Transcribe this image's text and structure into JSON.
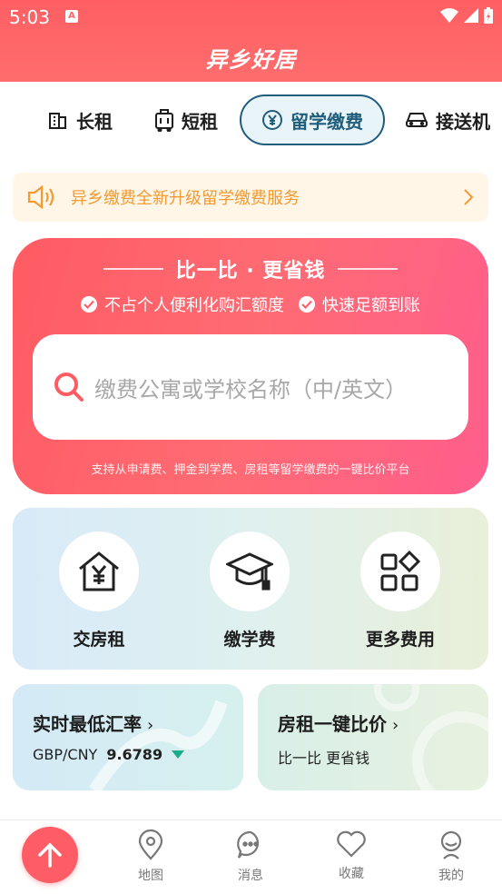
{
  "status_bar": {
    "time": "5:03",
    "notif_letter": "A"
  },
  "header": {
    "title": "异乡好居"
  },
  "tabs": [
    {
      "label": "长租",
      "icon": "building-icon"
    },
    {
      "label": "短租",
      "icon": "suitcase-icon"
    },
    {
      "label": "留学缴费",
      "icon": "yen-circle-icon",
      "active": true
    },
    {
      "label": "接送机",
      "icon": "car-icon"
    }
  ],
  "notice": {
    "text": "异乡缴费全新升级留学缴费服务"
  },
  "hero": {
    "title": "比一比 · 更省钱",
    "features": [
      "不占个人便利化购汇额度",
      "快速足额到账"
    ],
    "search_placeholder": "缴费公寓或学校名称（中/英文）",
    "subtitle": "支持从申请费、押金到学费、房租等留学缴费的一键比价平台"
  },
  "services": [
    {
      "label": "交房租",
      "icon": "house-yen-icon"
    },
    {
      "label": "缴学费",
      "icon": "graduation-cap-icon"
    },
    {
      "label": "更多费用",
      "icon": "grid-apps-icon"
    }
  ],
  "cards": {
    "rate": {
      "title": "实时最低汇率",
      "pair": "GBP/CNY",
      "value": "9.6789"
    },
    "compare": {
      "title": "房租一键比价",
      "subtitle": "比一比 更省钱"
    }
  },
  "bottom_nav": [
    {
      "label": "地图",
      "icon": "map-pin-icon"
    },
    {
      "label": "消息",
      "icon": "chat-bubble-icon"
    },
    {
      "label": "收藏",
      "icon": "heart-icon"
    },
    {
      "label": "我的",
      "icon": "user-icon"
    }
  ],
  "colors": {
    "primary": "#ff5f63",
    "active_tab": "#1f5d7b",
    "notice_text": "#f39a33",
    "rate_down": "#1bab8a"
  }
}
